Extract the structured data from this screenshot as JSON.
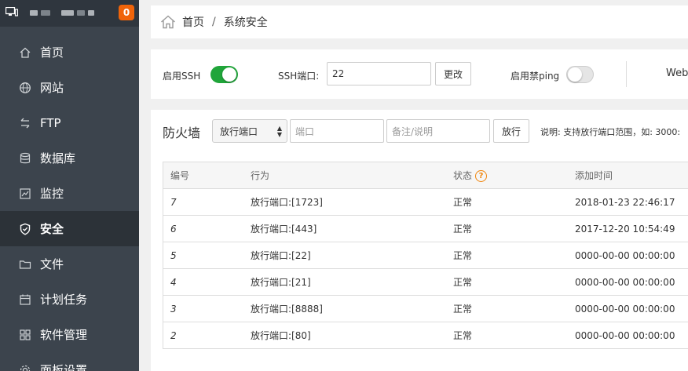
{
  "sidebar": {
    "badge": "0",
    "items": [
      {
        "label": "首页",
        "icon": "home-icon"
      },
      {
        "label": "网站",
        "icon": "globe-icon"
      },
      {
        "label": "FTP",
        "icon": "ftp-icon"
      },
      {
        "label": "数据库",
        "icon": "database-icon"
      },
      {
        "label": "监控",
        "icon": "monitor-chart-icon"
      },
      {
        "label": "安全",
        "icon": "shield-icon",
        "active": true
      },
      {
        "label": "文件",
        "icon": "folder-icon"
      },
      {
        "label": "计划任务",
        "icon": "calendar-icon"
      },
      {
        "label": "软件管理",
        "icon": "grid-icon"
      },
      {
        "label": "面板设置",
        "icon": "gear-icon"
      }
    ]
  },
  "breadcrumb": {
    "home": "首页",
    "separator": "/",
    "current": "系统安全"
  },
  "ssh": {
    "enable_label": "启用SSH",
    "enable_on": true,
    "port_label": "SSH端口:",
    "port_value": "22",
    "change_button": "更改",
    "noping_label": "启用禁ping",
    "noping_on": false,
    "web_label": "Web"
  },
  "firewall": {
    "title": "防火墙",
    "select_value": "放行端口",
    "port_placeholder": "端口",
    "remark_placeholder": "备注/说明",
    "allow_button": "放行",
    "note": "说明: 支持放行端口范围，如: 3000:",
    "columns": [
      "编号",
      "行为",
      "状态",
      "添加时间"
    ],
    "help_icon": "?",
    "rows": [
      {
        "id": "7",
        "action": "放行端口:[1723]",
        "status": "正常",
        "time": "2018-01-23 22:46:17"
      },
      {
        "id": "6",
        "action": "放行端口:[443]",
        "status": "正常",
        "time": "2017-12-20 10:54:49"
      },
      {
        "id": "5",
        "action": "放行端口:[22]",
        "status": "正常",
        "time": "0000-00-00 00:00:00"
      },
      {
        "id": "4",
        "action": "放行端口:[21]",
        "status": "正常",
        "time": "0000-00-00 00:00:00"
      },
      {
        "id": "3",
        "action": "放行端口:[8888]",
        "status": "正常",
        "time": "0000-00-00 00:00:00"
      },
      {
        "id": "2",
        "action": "放行端口:[80]",
        "status": "正常",
        "time": "0000-00-00 00:00:00"
      }
    ]
  },
  "colors": {
    "sidebar_bg": "#3c444d",
    "sidebar_active": "#2c3238",
    "accent_green": "#20a53a",
    "badge_orange": "#f0640a"
  }
}
